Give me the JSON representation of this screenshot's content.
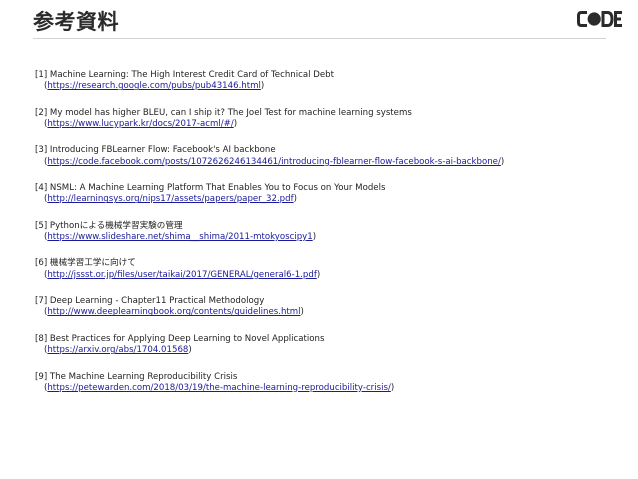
{
  "header": {
    "title": "参考資料",
    "logo_text": "CODE"
  },
  "references": [
    {
      "label": "[1] Machine Learning: The High Interest Credit Card of Technical Debt",
      "url": "https://research.google.com/pubs/pub43146.html"
    },
    {
      "label": "[2] My model has higher BLEU, can I ship it? The Joel Test for machine learning systems",
      "url": "https://www.lucypark.kr/docs/2017-acml/#/"
    },
    {
      "label": "[3] Introducing FBLearner Flow: Facebook's AI backbone",
      "url": "https://code.facebook.com/posts/1072626246134461/introducing-fblearner-flow-facebook-s-ai-backbone/"
    },
    {
      "label": "[4] NSML: A Machine Learning Platform That Enables You to Focus on Your Models",
      "url": "http://learningsys.org/nips17/assets/papers/paper_32.pdf"
    },
    {
      "label": "[5] Pythonによる機械学習実験の管理",
      "url": "https://www.slideshare.net/shima__shima/2011-mtokyoscipy1"
    },
    {
      "label": "[6] 機械学習工学に向けて",
      "url": "http://jssst.or.jp/files/user/taikai/2017/GENERAL/general6-1.pdf"
    },
    {
      "label": "[7] Deep Learning - Chapter11 Practical Methodology",
      "url": "http://www.deeplearningbook.org/contents/guidelines.html"
    },
    {
      "label": "[8] Best Practices for Applying Deep Learning to Novel Applications",
      "url": "https://arxiv.org/abs/1704.01568"
    },
    {
      "label": "[9] The Machine Learning Reproducibility Crisis",
      "url": "https://petewarden.com/2018/03/19/the-machine-learning-reproducibility-crisis/"
    }
  ]
}
